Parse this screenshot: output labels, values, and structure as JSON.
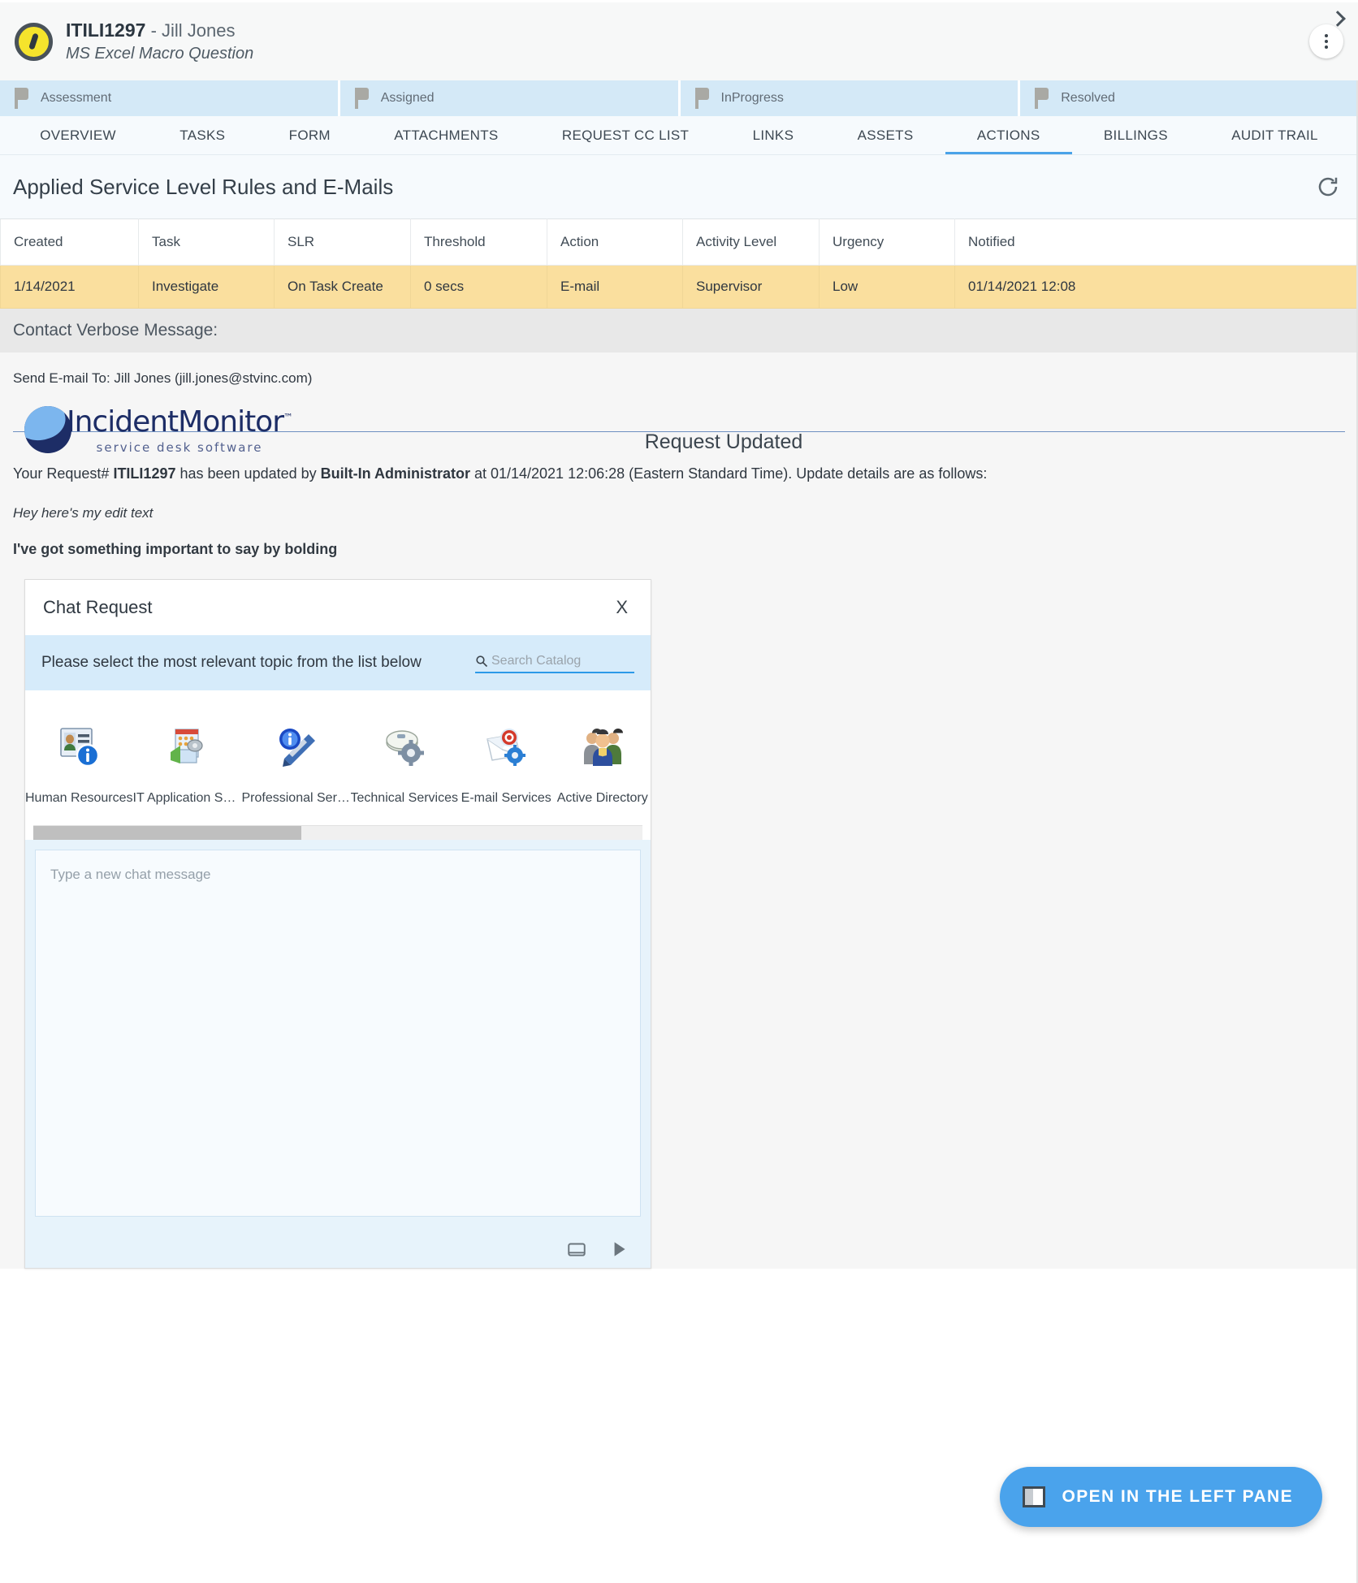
{
  "header": {
    "ticket_id": "ITILI1297",
    "requester": "- Jill Jones",
    "subject": "MS Excel Macro Question",
    "menu_icon": "kebab-menu-icon",
    "expand_icon": "chevron-right-icon"
  },
  "status_flags": [
    {
      "label": "Assessment"
    },
    {
      "label": "Assigned"
    },
    {
      "label": "InProgress"
    },
    {
      "label": "Resolved"
    }
  ],
  "tabs": [
    {
      "label": "OVERVIEW",
      "active": false
    },
    {
      "label": "TASKS",
      "active": false
    },
    {
      "label": "FORM",
      "active": false
    },
    {
      "label": "ATTACHMENTS",
      "active": false
    },
    {
      "label": "REQUEST CC LIST",
      "active": false
    },
    {
      "label": "LINKS",
      "active": false
    },
    {
      "label": "ASSETS",
      "active": false
    },
    {
      "label": "ACTIONS",
      "active": true
    },
    {
      "label": "BILLINGS",
      "active": false
    },
    {
      "label": "AUDIT TRAIL",
      "active": false
    }
  ],
  "section": {
    "title": "Applied Service Level Rules and E-Mails",
    "refresh_icon": "refresh-icon"
  },
  "table": {
    "columns": [
      "Created",
      "Task",
      "SLR",
      "Threshold",
      "Action",
      "Activity Level",
      "Urgency",
      "Notified"
    ],
    "rows": [
      {
        "created": "1/14/2021",
        "task": "Investigate",
        "slr": "On Task Create",
        "threshold": "0 secs",
        "action": "E-mail",
        "activity_level": "Supervisor",
        "urgency": "Low",
        "notified": "01/14/2021 12:08"
      }
    ]
  },
  "verbose": {
    "heading": "Contact Verbose Message:",
    "send_to": "Send E-mail To: Jill Jones (jill.jones@stvinc.com)"
  },
  "email": {
    "brand_name": "IncidentMonitor",
    "brand_tm": "™",
    "brand_tagline": "service desk software",
    "title": "Request Updated",
    "line_prefix": "Your Request# ",
    "request_id": "ITILI1297",
    "line_mid": " has been updated by ",
    "updated_by": "Built-In Administrator",
    "line_suffix": " at 01/14/2021 12:06:28 (Eastern Standard Time). Update details are as follows:",
    "italic_note": "Hey here's my edit text",
    "bold_note": "I've got something important to say by bolding"
  },
  "chat": {
    "title": "Chat Request",
    "close_label": "X",
    "prompt": "Please select the most relevant topic from the list below",
    "search_placeholder": "Search Catalog",
    "search_value": "",
    "search_icon": "search-icon",
    "catalog": [
      {
        "label": "Human Resources",
        "icon": "human-resources-icon"
      },
      {
        "label": "IT Application Servi...",
        "icon": "it-application-services-icon"
      },
      {
        "label": "Professional Servic...",
        "icon": "professional-services-icon"
      },
      {
        "label": "Technical Services",
        "icon": "technical-services-icon"
      },
      {
        "label": "E-mail Services",
        "icon": "email-services-icon"
      },
      {
        "label": "Active Directory",
        "icon": "active-directory-icon"
      }
    ],
    "message_placeholder": "Type a new chat message",
    "message_value": "",
    "attach_icon": "attachment-icon",
    "send_icon": "send-icon"
  },
  "floating_button": {
    "label": "OPEN IN THE LEFT PANE",
    "icon": "left-pane-icon"
  },
  "colors": {
    "accent": "#4aa3ec",
    "flag_bg": "#d4e9f7",
    "row_highlight": "#fadf9e",
    "brand_navy": "#1d2d66"
  }
}
